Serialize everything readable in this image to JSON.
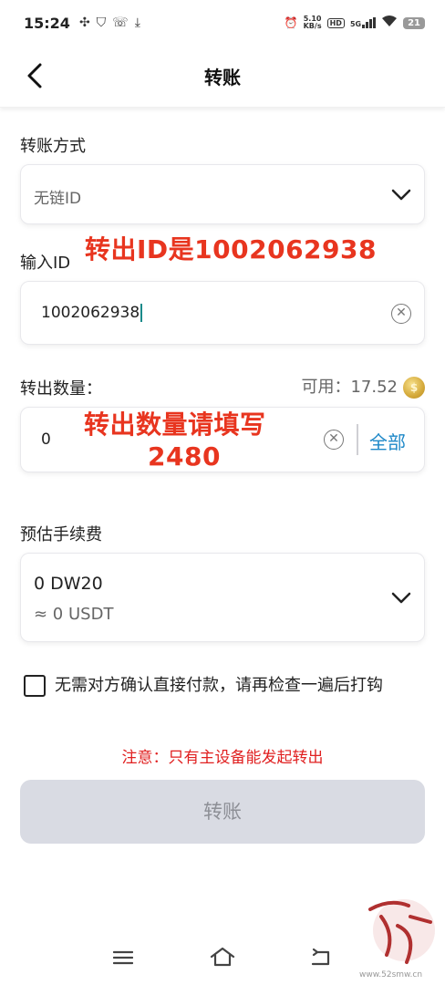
{
  "status_bar": {
    "time": "15:24",
    "network_speed_value": "5.10",
    "network_speed_unit": "KB/s",
    "hd_label": "HD",
    "network_type": "5G",
    "battery": "21"
  },
  "header": {
    "title": "转账"
  },
  "transfer_method": {
    "label": "转账方式",
    "value": "无链ID"
  },
  "recipient": {
    "label": "输入ID",
    "value": "1002062938"
  },
  "amount": {
    "label": "转出数量：",
    "available_label": "可用：",
    "available_value": "17.52",
    "value": "0",
    "all_label": "全部"
  },
  "fee": {
    "label": "预估手续费",
    "value": "0 DW20",
    "approx": "≈ 0 USDT"
  },
  "confirm": {
    "text": "无需对方确认直接付款，请再检查一遍后打钩",
    "checked": false
  },
  "notice": "注意：只有主设备能发起转出",
  "submit_label": "转账",
  "annotations": {
    "id_note": "转出ID是1002062938",
    "amount_note_line1": "转出数量请填写",
    "amount_note_line2": "2480"
  },
  "watermark": {
    "site": "www.52smw.cn"
  },
  "colors": {
    "accent": "#1e88c8",
    "annotation_red": "#e8351f",
    "notice_red": "#e02020",
    "disabled_button": "#d9dbe3"
  }
}
